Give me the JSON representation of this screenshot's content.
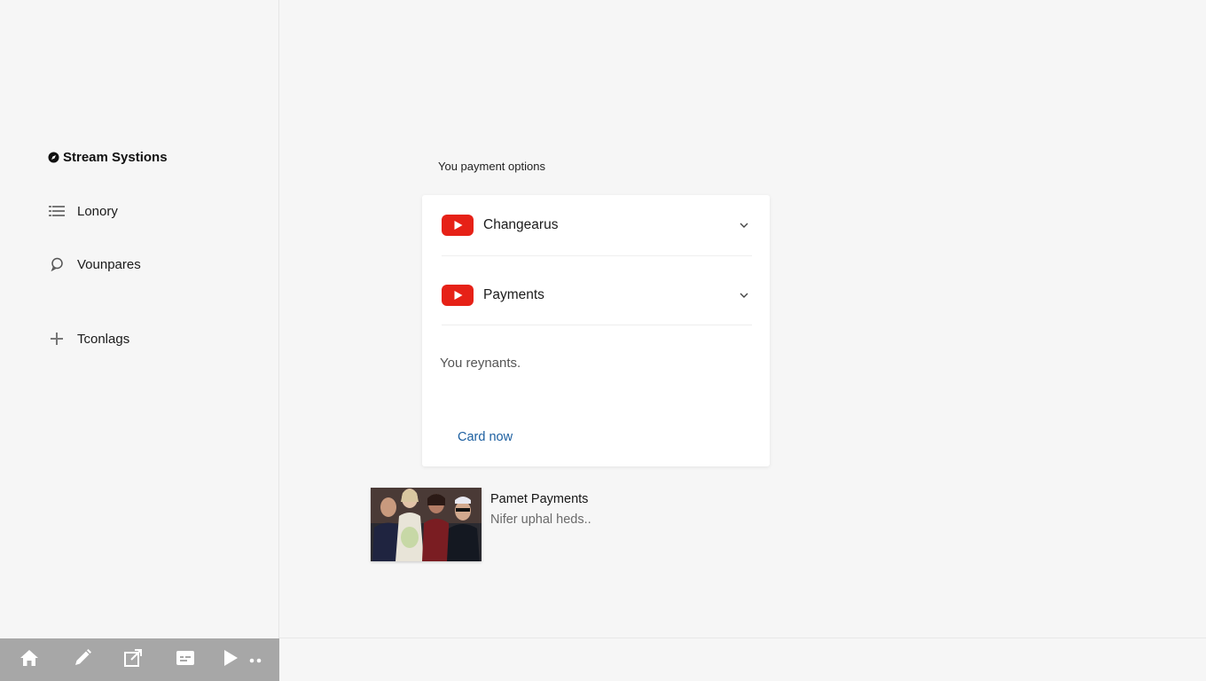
{
  "sidebar": {
    "brand": "Stream Systions",
    "items": [
      {
        "label": "Lonory",
        "icon": "list-icon"
      },
      {
        "label": "Vounpares",
        "icon": "chat-bubble-icon"
      },
      {
        "label": "Tconlags",
        "icon": "plus-icon"
      }
    ]
  },
  "bottom_bar": {
    "icons": [
      "home-icon",
      "pencil-icon",
      "export-icon",
      "caption-icon",
      "play-icon",
      "more-icon"
    ]
  },
  "main": {
    "section_title": "You payment options",
    "card": {
      "options": [
        {
          "label": "Changearus",
          "icon": "youtube-play-icon"
        },
        {
          "label": "Payments",
          "icon": "youtube-play-icon"
        }
      ],
      "note": "You reynants.",
      "link": "Card now"
    },
    "media": {
      "title": "Pamet Payments",
      "subtitle": "Nifer uphal heds.."
    }
  },
  "colors": {
    "youtube_red": "#e62117",
    "link_blue": "#1c5fa0",
    "bottom_bar": "#a7a7a7"
  }
}
